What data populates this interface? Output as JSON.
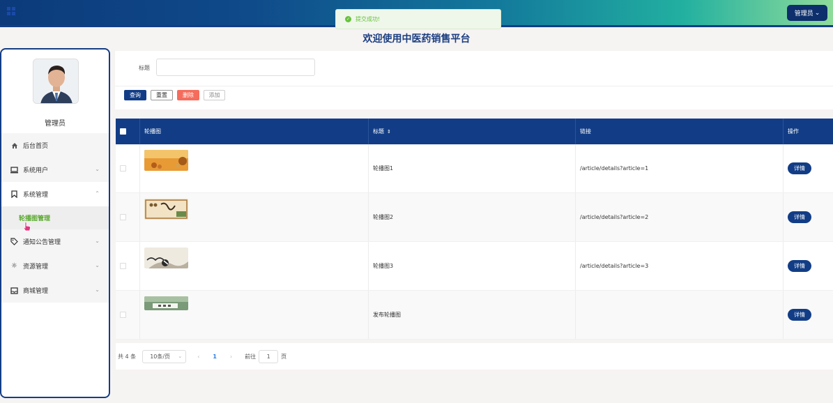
{
  "topbar": {
    "admin_label": "管理员",
    "toast": "提交成功!"
  },
  "page_title": "欢迎使用中医药销售平台",
  "sidebar": {
    "user_name": "管理员",
    "items": [
      {
        "label": "后台首页",
        "icon": "home-icon"
      },
      {
        "label": "系统用户",
        "icon": "monitor-icon"
      },
      {
        "label": "系统管理",
        "icon": "bookmark-icon"
      },
      {
        "label": "轮播图管理",
        "icon": ""
      },
      {
        "label": "通知公告管理",
        "icon": "tag-icon"
      },
      {
        "label": "资源管理",
        "icon": "sun-icon"
      },
      {
        "label": "商城管理",
        "icon": "inbox-icon"
      }
    ]
  },
  "search": {
    "label": "标题",
    "value": ""
  },
  "buttons": {
    "query": "查询",
    "reset": "重置",
    "delete": "删除",
    "add": "添加"
  },
  "table": {
    "headers": {
      "image": "轮播图",
      "title": "标题",
      "link": "链接",
      "op": "操作"
    },
    "rows": [
      {
        "title": "轮播图1",
        "link": "/article/details?article=1",
        "action": "详情"
      },
      {
        "title": "轮播图2",
        "link": "/article/details?article=2",
        "action": "详情"
      },
      {
        "title": "轮播图3",
        "link": "/article/details?article=3",
        "action": "详情"
      },
      {
        "title": "发布轮播图",
        "link": "",
        "action": "详情"
      }
    ]
  },
  "pagination": {
    "total": "共 4 条",
    "page_size": "10条/页",
    "current": "1",
    "goto_label": "前往",
    "goto_value": "1",
    "page_suffix": "页"
  },
  "colors": {
    "primary": "#123d86",
    "danger": "#f56c5c",
    "success": "#67c23a",
    "active_menu": "#5aa82e"
  }
}
